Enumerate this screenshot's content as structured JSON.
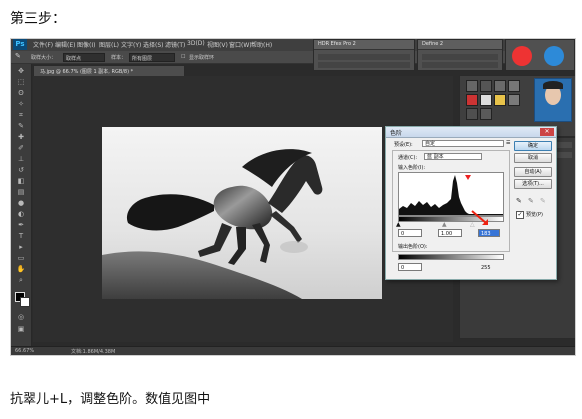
{
  "captions": {
    "top": "第三步：",
    "bottom": "抗翠儿+L，调整色阶。数值见图中"
  },
  "app": {
    "logo": "Ps",
    "menu": [
      "文件(F)",
      "编辑(E)",
      "图像(I)",
      "图层(L)",
      "文字(Y)",
      "选择(S)",
      "滤镜(T)",
      "3D(D)",
      "视图(V)",
      "窗口(W)",
      "帮助(H)"
    ],
    "options": {
      "sample_size_label": "取样大小：",
      "sample_size_value": "取样点",
      "sample_label": "样本：",
      "sample_value": "所有图层",
      "show_ring": "显示取样环"
    },
    "doc_tab": "马.jpg @ 66.7% (图层 1 副本, RGB/8) *",
    "status": {
      "zoom": "66.67%",
      "doc": "文档:1.86M/4.38M"
    },
    "panels": {
      "panel1_title": "HDR Efex Pro 2",
      "panel2_title": "Define 2"
    }
  },
  "levels": {
    "title": "色阶",
    "preset_label": "预设(E):",
    "preset_value": "自定",
    "channel_label": "通道(C):",
    "channel_value": "蓝 副本",
    "input_label": "输入色阶(I):",
    "input_black": "0",
    "input_gray": "1.00",
    "input_white": "183",
    "output_label": "输出色阶(O):",
    "output_black": "0",
    "output_white": "255",
    "buttons": {
      "ok": "确定",
      "cancel": "取消",
      "auto": "自动(A)",
      "options": "选项(T)..."
    },
    "preview_label": "预览(P)",
    "preview_checked": true
  }
}
